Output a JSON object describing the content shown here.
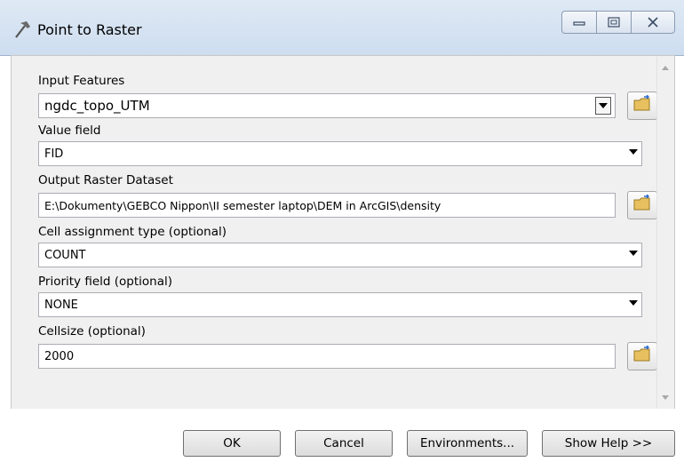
{
  "window": {
    "title": "Point to Raster",
    "title_icon": "hammer-icon",
    "controls": {
      "minimize_icon": "minimize-icon",
      "maximize_icon": "maximize-icon",
      "close_icon": "close-icon"
    }
  },
  "form": {
    "input_features": {
      "label": "Input Features",
      "value": "ngdc_topo_UTM"
    },
    "value_field": {
      "label": "Value field",
      "value": "FID"
    },
    "output_raster": {
      "label": "Output Raster Dataset",
      "value": "E:\\Dokumenty\\GEBCO Nippon\\II semester laptop\\DEM in ArcGIS\\density"
    },
    "cell_assignment": {
      "label": "Cell assignment type (optional)",
      "value": "COUNT"
    },
    "priority_field": {
      "label": "Priority field (optional)",
      "value": "NONE"
    },
    "cellsize": {
      "label": "Cellsize (optional)",
      "value": "2000"
    }
  },
  "buttons": {
    "ok": "OK",
    "cancel": "Cancel",
    "environments": "Environments...",
    "show_help": "Show Help >>"
  },
  "colors": {
    "titlebar": "#d6e3f2",
    "panel": "#f0f0f0",
    "folder": "#e8c060"
  }
}
